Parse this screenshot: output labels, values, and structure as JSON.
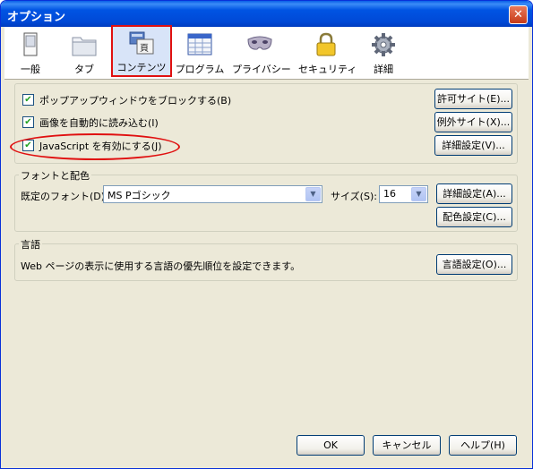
{
  "window": {
    "title": "オプション"
  },
  "tabs": [
    {
      "label": "一般",
      "icon": "general-icon"
    },
    {
      "label": "タブ",
      "icon": "tabs-folder-icon"
    },
    {
      "label": "コンテンツ",
      "icon": "content-icon",
      "selected": true
    },
    {
      "label": "プログラム",
      "icon": "programs-icon"
    },
    {
      "label": "プライバシー",
      "icon": "privacy-mask-icon"
    },
    {
      "label": "セキュリティ",
      "icon": "security-lock-icon"
    },
    {
      "label": "詳細",
      "icon": "advanced-gear-icon"
    }
  ],
  "content": {
    "popup": {
      "label": "ポップアップウィンドウをブロックする(B)",
      "checked": true,
      "button": "許可サイト(E)..."
    },
    "images": {
      "label": "画像を自動的に読み込む(I)",
      "checked": true,
      "button": "例外サイト(X)..."
    },
    "javascript": {
      "label": "JavaScript を有効にする(J)",
      "checked": true,
      "button": "詳細設定(V)..."
    }
  },
  "fonts": {
    "legend": "フォントと配色",
    "default_font_label": "既定のフォント(D):",
    "default_font_value": "MS Pゴシック",
    "size_label": "サイズ(S):",
    "size_value": "16",
    "advanced_button": "詳細設定(A)...",
    "colors_button": "配色設定(C)..."
  },
  "language": {
    "legend": "言語",
    "description": "Web ページの表示に使用する言語の優先順位を設定できます。",
    "button": "言語設定(O)..."
  },
  "footer": {
    "ok": "OK",
    "cancel": "キャンセル",
    "help": "ヘルプ(H)"
  },
  "colors": {
    "title_bar": "#0054e3",
    "highlight": "#e01010",
    "dialog_bg": "#ece9d8"
  }
}
